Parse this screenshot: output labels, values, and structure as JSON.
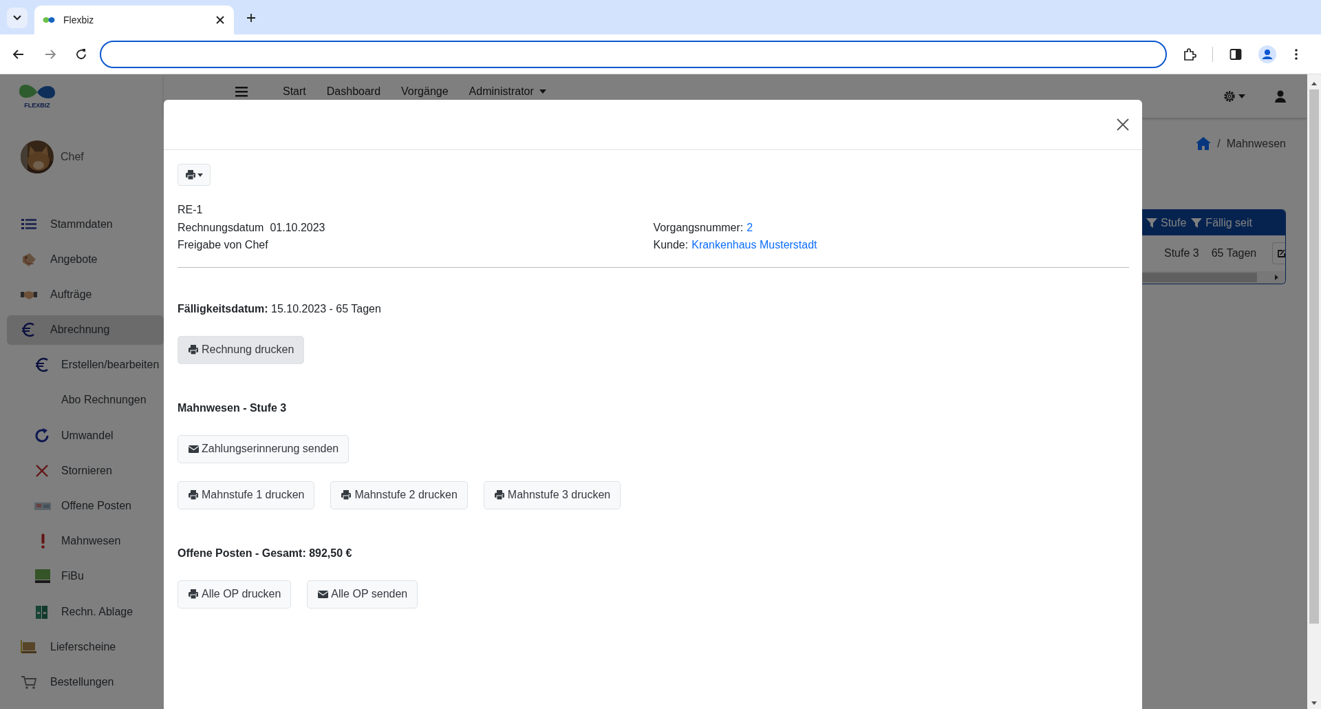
{
  "browser": {
    "tabs": [
      {
        "title": "Flexbiz",
        "selected": true
      }
    ]
  },
  "sidebar": {
    "logo": "FLEXBIZ",
    "user": "Chef",
    "items": [
      {
        "label": "Stammdaten",
        "selected": false
      },
      {
        "label": "Angebote",
        "selected": false
      },
      {
        "label": "Aufträge",
        "selected": false
      },
      {
        "label": "Abrechnung",
        "selected": true,
        "children": [
          {
            "label": "Erstellen/bearbeiten",
            "selected": false
          },
          {
            "label": "Abo Rechnungen",
            "selected": false
          },
          {
            "label": "Umwandel",
            "selected": false
          },
          {
            "label": "Stornieren",
            "selected": false
          },
          {
            "label": "Offene Posten",
            "selected": false
          },
          {
            "label": "Mahnwesen",
            "selected": false
          },
          {
            "label": "FiBu",
            "selected": false
          },
          {
            "label": "Rechn. Ablage",
            "selected": false
          }
        ]
      },
      {
        "label": "Lieferscheine",
        "selected": false
      },
      {
        "label": "Bestellungen",
        "selected": false
      }
    ]
  },
  "topbar": {
    "items": [
      {
        "label": "Start",
        "dropdown": false
      },
      {
        "label": "Dashboard",
        "dropdown": false
      },
      {
        "label": "Vorgänge",
        "dropdown": false
      },
      {
        "label": "Administrator",
        "dropdown": true
      }
    ]
  },
  "breadcrumb": [
    {
      "separator": "/",
      "label": "Mahnwesen"
    }
  ],
  "table": {
    "columns": [
      "Stufe",
      "Fällig seit"
    ],
    "rows": [
      [
        "Stufe 3",
        "65 Tagen"
      ]
    ]
  },
  "modal": {
    "details_left": [
      {
        "label": "RE-1"
      },
      {
        "label": "Rechnungsdatum",
        "value": "01.10.2023"
      },
      {
        "label": "Freigabe von Chef"
      }
    ],
    "details_right": [
      {
        "label": "Vorgangsnummer:",
        "link": "2"
      },
      {
        "label": "Kunde:",
        "link": "Krankenhaus Musterstadt"
      }
    ],
    "sections": [
      {
        "title": "Fälligkeitsdatum:",
        "value": "15.10.2023 - 65 Tagen",
        "button_rows": [
          [
            {
              "label": "Rechnung drucken",
              "kind": "print",
              "focused": true
            }
          ]
        ]
      },
      {
        "title": "Mahnwesen - Stufe 3",
        "button_rows": [
          [
            {
              "label": "Zahlungserinnerung senden",
              "kind": "mail",
              "focused": false
            }
          ],
          [
            {
              "label": "Mahnstufe 1 drucken",
              "kind": "print",
              "focused": false
            },
            {
              "label": "Mahnstufe 2 drucken",
              "kind": "print",
              "focused": false
            },
            {
              "label": "Mahnstufe 3 drucken",
              "kind": "print",
              "focused": false
            }
          ]
        ]
      },
      {
        "title": "Offene Posten - Gesamt: 892,50 €",
        "button_rows": [
          [
            {
              "label": "Alle OP drucken",
              "kind": "print",
              "focused": false
            },
            {
              "label": "Alle OP senden",
              "kind": "mail",
              "focused": false
            }
          ]
        ]
      }
    ]
  }
}
